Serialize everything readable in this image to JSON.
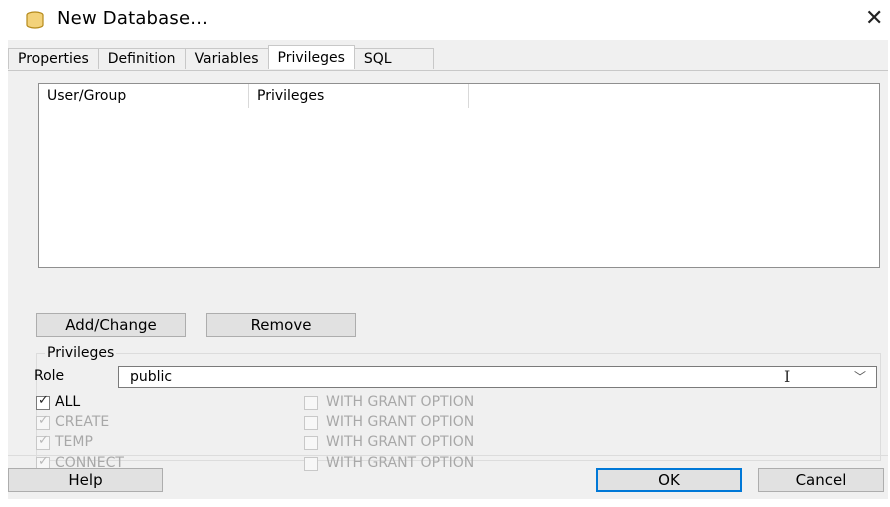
{
  "window": {
    "title": "New Database...",
    "close_glyph": "✕",
    "icon": "database-icon"
  },
  "tabs": [
    {
      "label": "Properties"
    },
    {
      "label": "Definition"
    },
    {
      "label": "Variables"
    },
    {
      "label": "Privileges",
      "active": true
    },
    {
      "label": "SQL"
    }
  ],
  "list": {
    "columns": [
      "User/Group",
      "Privileges"
    ],
    "rows": []
  },
  "buttons": {
    "add_change": "Add/Change",
    "remove": "Remove",
    "help": "Help",
    "ok": "OK",
    "cancel": "Cancel"
  },
  "privileges_group": {
    "title": "Privileges",
    "role_label": "Role",
    "role_value": "public",
    "grant_option_label": "WITH GRANT OPTION",
    "items": [
      {
        "label": "ALL",
        "checked": true,
        "disabled": false,
        "grant_checked": false
      },
      {
        "label": "CREATE",
        "checked": true,
        "disabled": true,
        "grant_checked": false
      },
      {
        "label": "TEMP",
        "checked": true,
        "disabled": true,
        "grant_checked": false
      },
      {
        "label": "CONNECT",
        "checked": true,
        "disabled": true,
        "grant_checked": false
      }
    ]
  }
}
